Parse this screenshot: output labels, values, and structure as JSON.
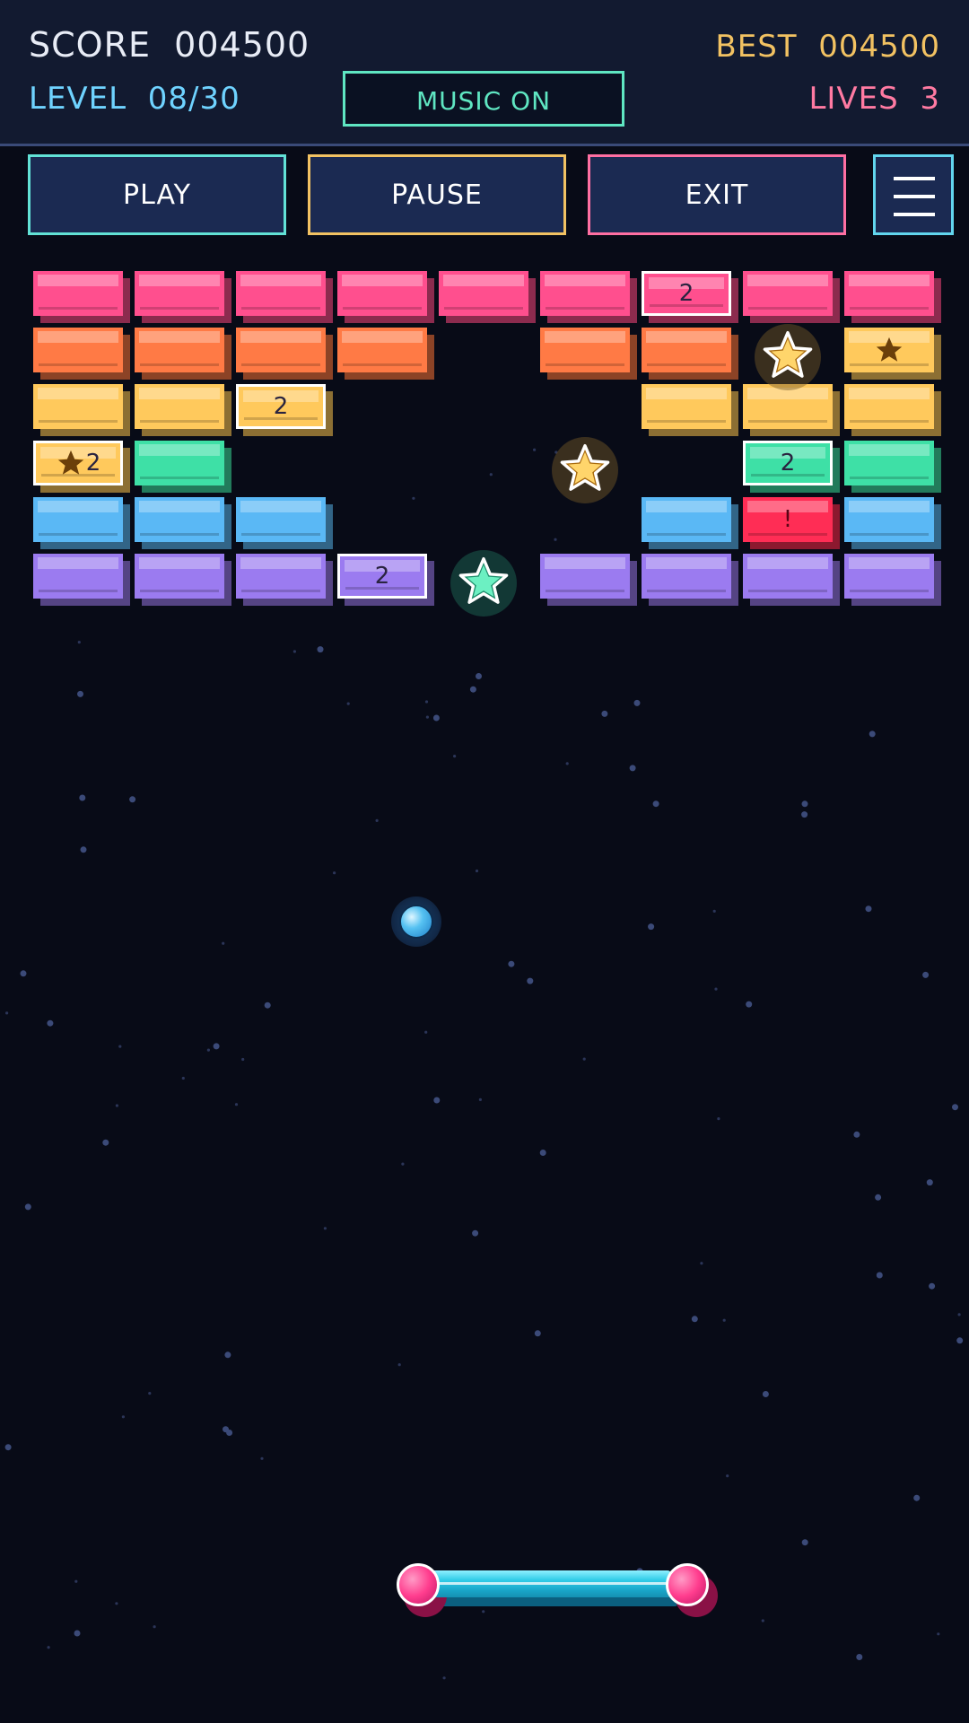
{
  "hud": {
    "score_label": "SCORE",
    "score_value": "004500",
    "best_label": "BEST",
    "best_value": "004500",
    "level_label": "LEVEL",
    "level_value": "08/30",
    "lives_label": "LIVES",
    "lives_value": "3",
    "music_label": "MUSIC ON"
  },
  "buttons": {
    "play": "PLAY",
    "pause": "PAUSE",
    "exit": "EXIT",
    "menu_icon": "hamburger-menu-icon"
  },
  "colors": {
    "pink": "#ff4f8e",
    "orange": "#ff7a45",
    "yellow": "#ffc95c",
    "green": "#3ee0a6",
    "blue": "#5ab8f5",
    "purple": "#9b7bf0",
    "red": "#ff2d55"
  },
  "bricks": [
    {
      "row": 0,
      "col": 0,
      "color": "pink",
      "label": ""
    },
    {
      "row": 0,
      "col": 1,
      "color": "pink",
      "label": ""
    },
    {
      "row": 0,
      "col": 2,
      "color": "pink",
      "label": ""
    },
    {
      "row": 0,
      "col": 3,
      "color": "pink",
      "label": ""
    },
    {
      "row": 0,
      "col": 4,
      "color": "pink",
      "label": ""
    },
    {
      "row": 0,
      "col": 5,
      "color": "pink",
      "label": ""
    },
    {
      "row": 0,
      "col": 6,
      "color": "pink",
      "label": "2",
      "hit": true
    },
    {
      "row": 0,
      "col": 7,
      "color": "pink",
      "label": ""
    },
    {
      "row": 0,
      "col": 8,
      "color": "pink",
      "label": ""
    },
    {
      "row": 1,
      "col": 0,
      "color": "orange",
      "label": ""
    },
    {
      "row": 1,
      "col": 1,
      "color": "orange",
      "label": ""
    },
    {
      "row": 1,
      "col": 2,
      "color": "orange",
      "label": ""
    },
    {
      "row": 1,
      "col": 3,
      "color": "orange",
      "label": ""
    },
    {
      "row": 1,
      "col": 5,
      "color": "orange",
      "label": ""
    },
    {
      "row": 1,
      "col": 6,
      "color": "orange",
      "label": ""
    },
    {
      "row": 1,
      "col": 8,
      "color": "yellow",
      "label": "",
      "star": true
    },
    {
      "row": 2,
      "col": 0,
      "color": "yellow",
      "label": ""
    },
    {
      "row": 2,
      "col": 1,
      "color": "yellow",
      "label": ""
    },
    {
      "row": 2,
      "col": 2,
      "color": "yellow",
      "label": "2",
      "hit": true
    },
    {
      "row": 2,
      "col": 6,
      "color": "yellow",
      "label": ""
    },
    {
      "row": 2,
      "col": 7,
      "color": "yellow",
      "label": ""
    },
    {
      "row": 2,
      "col": 8,
      "color": "yellow",
      "label": ""
    },
    {
      "row": 3,
      "col": 0,
      "color": "yellow",
      "label": "2",
      "hit": true,
      "star": true
    },
    {
      "row": 3,
      "col": 1,
      "color": "green",
      "label": ""
    },
    {
      "row": 3,
      "col": 7,
      "color": "green",
      "label": "2",
      "hit": true
    },
    {
      "row": 3,
      "col": 8,
      "color": "green",
      "label": ""
    },
    {
      "row": 4,
      "col": 0,
      "color": "blue",
      "label": ""
    },
    {
      "row": 4,
      "col": 1,
      "color": "blue",
      "label": ""
    },
    {
      "row": 4,
      "col": 2,
      "color": "blue",
      "label": ""
    },
    {
      "row": 4,
      "col": 6,
      "color": "blue",
      "label": ""
    },
    {
      "row": 4,
      "col": 7,
      "color": "red",
      "label": "!"
    },
    {
      "row": 4,
      "col": 8,
      "color": "blue",
      "label": ""
    },
    {
      "row": 5,
      "col": 0,
      "color": "purple",
      "label": ""
    },
    {
      "row": 5,
      "col": 1,
      "color": "purple",
      "label": ""
    },
    {
      "row": 5,
      "col": 2,
      "color": "purple",
      "label": ""
    },
    {
      "row": 5,
      "col": 3,
      "color": "purple",
      "label": "2",
      "hit": true
    },
    {
      "row": 5,
      "col": 5,
      "color": "purple",
      "label": ""
    },
    {
      "row": 5,
      "col": 6,
      "color": "purple",
      "label": ""
    },
    {
      "row": 5,
      "col": 7,
      "color": "purple",
      "label": ""
    },
    {
      "row": 5,
      "col": 8,
      "color": "purple",
      "label": ""
    }
  ],
  "powerups": [
    {
      "row": 1,
      "col": 7,
      "type": "gold-star-icon",
      "color": "#ffd56b"
    },
    {
      "row": 3,
      "col": 5,
      "type": "gold-star-icon",
      "color": "#ffd56b"
    },
    {
      "row": 5,
      "col": 4,
      "type": "green-star-icon",
      "color": "#6cf0c2"
    }
  ],
  "ball_icon": "ball-icon",
  "paddle_icon": "paddle-icon"
}
